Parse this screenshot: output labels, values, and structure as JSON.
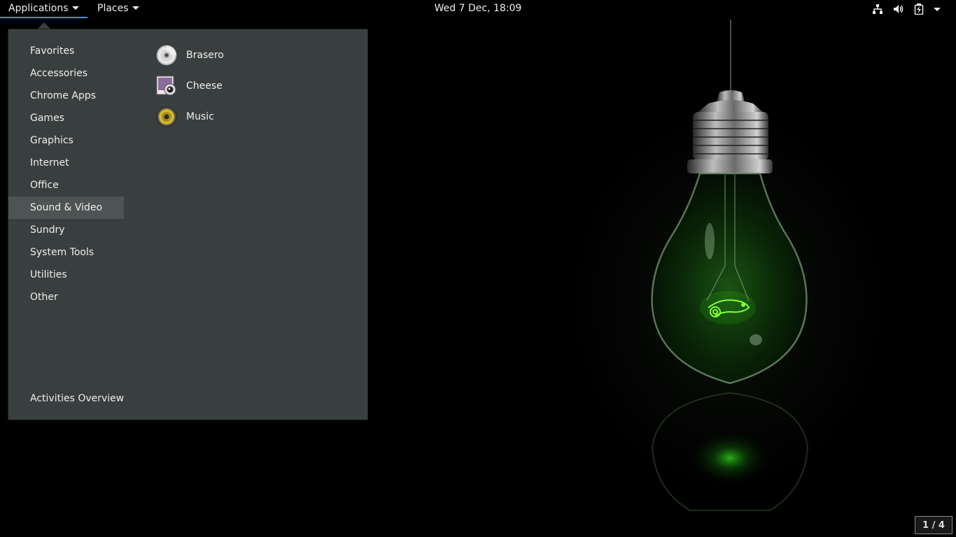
{
  "topbar": {
    "applications_label": "Applications",
    "places_label": "Places",
    "clock": "Wed  7 Dec, 18:09",
    "status_icons": [
      "network-wired-icon",
      "volume-icon",
      "battery-charging-icon"
    ]
  },
  "menu": {
    "categories": [
      {
        "label": "Favorites"
      },
      {
        "label": "Accessories"
      },
      {
        "label": "Chrome Apps"
      },
      {
        "label": "Games"
      },
      {
        "label": "Graphics"
      },
      {
        "label": "Internet"
      },
      {
        "label": "Office"
      },
      {
        "label": "Sound & Video"
      },
      {
        "label": "Sundry"
      },
      {
        "label": "System Tools"
      },
      {
        "label": "Utilities"
      },
      {
        "label": "Other"
      }
    ],
    "selected_category": "Sound & Video",
    "apps": [
      {
        "label": "Brasero",
        "icon": "disc-burner-icon"
      },
      {
        "label": "Cheese",
        "icon": "webcam-icon"
      },
      {
        "label": "Music",
        "icon": "speaker-icon"
      }
    ],
    "activities_label": "Activities Overview"
  },
  "workspace": {
    "indicator": "1 / 4"
  },
  "colors": {
    "menu_bg": "#393f3f",
    "selected_bg": "#4e5454",
    "accent": "#4a90d9",
    "glow": "#39c928"
  }
}
